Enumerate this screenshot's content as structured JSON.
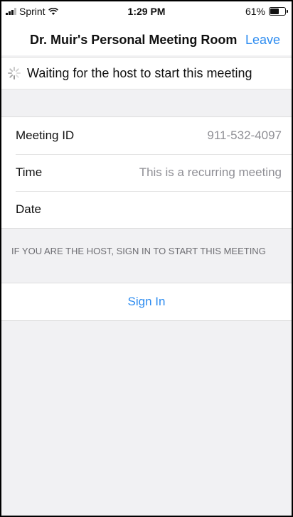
{
  "status_bar": {
    "carrier": "Sprint",
    "time": "1:29 PM",
    "battery_text": "61%",
    "battery_level": 0.61
  },
  "header": {
    "title": "Dr. Muir's Personal Meeting Room",
    "leave_label": "Leave"
  },
  "waiting": {
    "message": "Waiting for the host to start this meeting",
    "icon": "spinner-icon"
  },
  "details": {
    "rows": [
      {
        "label": "Meeting ID",
        "value": "911-532-4097"
      },
      {
        "label": "Time",
        "value": "This is a recurring meeting"
      },
      {
        "label": "Date",
        "value": ""
      }
    ]
  },
  "host_hint": "IF YOU ARE THE HOST, SIGN IN TO START THIS MEETING",
  "sign_in_label": "Sign In",
  "colors": {
    "accent": "#2d8cf0",
    "secondary_text": "#8f8f95",
    "background": "#f1f1f3"
  }
}
